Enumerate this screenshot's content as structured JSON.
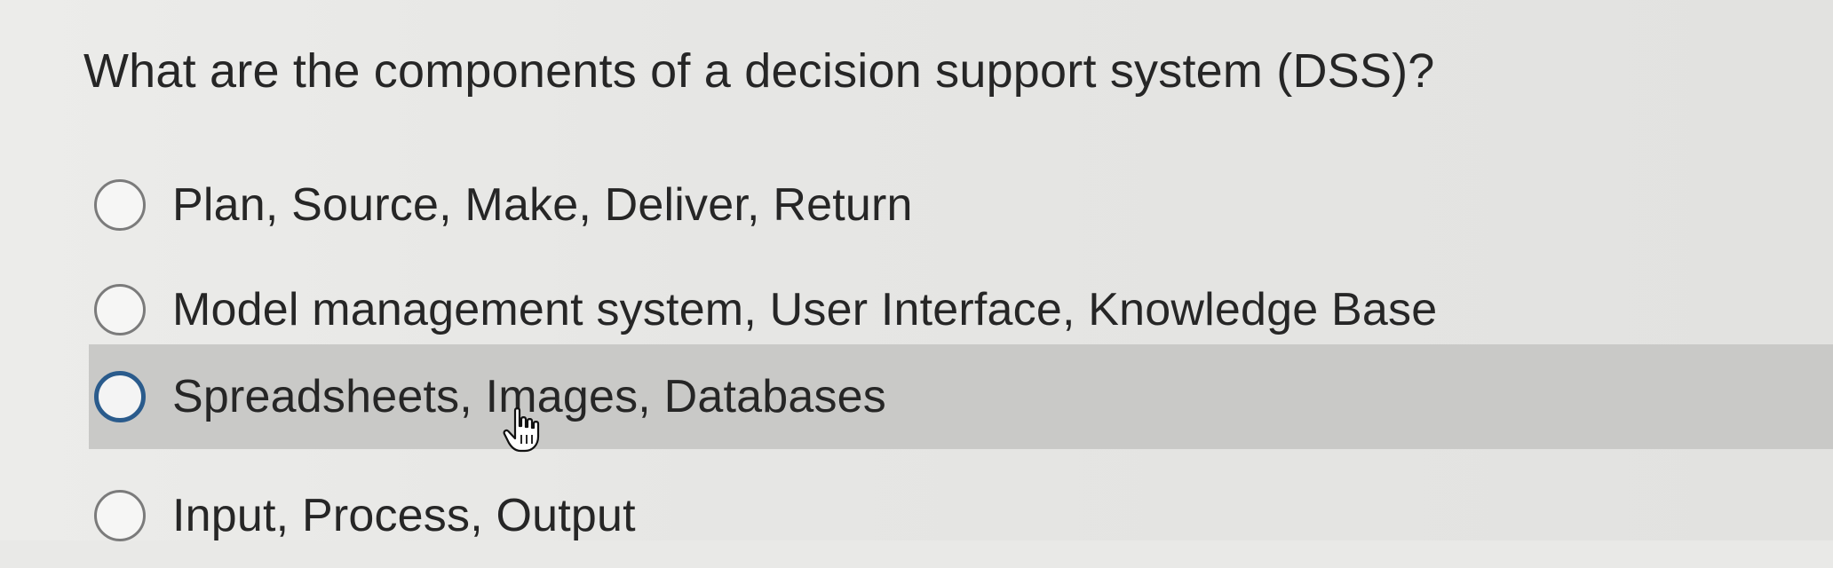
{
  "question": {
    "text": "What are the components of a decision support system (DSS)?"
  },
  "options": [
    {
      "label": "Plan, Source, Make, Deliver, Return",
      "selected": false,
      "hovered": false
    },
    {
      "label": "Model management system, User Interface, Knowledge Base",
      "selected": false,
      "hovered": false
    },
    {
      "label": "Spreadsheets, Images, Databases",
      "selected": false,
      "hovered": true
    },
    {
      "label": "Input, Process, Output",
      "selected": false,
      "hovered": false
    }
  ],
  "cursor": {
    "icon": "hand-pointer-icon"
  },
  "colors": {
    "hover_background": "#c9c9c7",
    "focus_ring": "#2a5b8c",
    "text": "#262626"
  }
}
